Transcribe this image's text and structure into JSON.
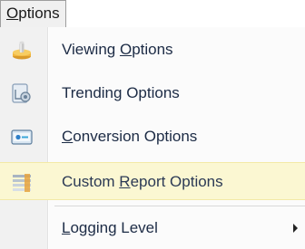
{
  "menubar": {
    "options": {
      "pre": "",
      "ul": "O",
      "post": "ptions"
    }
  },
  "menu": {
    "viewing": {
      "pre": "Viewing ",
      "ul": "O",
      "post": "ptions",
      "icon": "viewing-options-icon"
    },
    "trending": {
      "pre": "Trending Options",
      "ul": "",
      "post": "",
      "icon": "trending-options-icon"
    },
    "conversion": {
      "pre": "",
      "ul": "C",
      "post": "onversion Options",
      "icon": "conversion-options-icon"
    },
    "custom_report": {
      "pre": "Custom ",
      "ul": "R",
      "post": "eport Options",
      "icon": "custom-report-options-icon",
      "highlighted": true
    },
    "logging": {
      "pre": "",
      "ul": "L",
      "post": "ogging Level",
      "has_submenu": true
    }
  },
  "colors": {
    "highlight_bg": "#fbf7d2",
    "text": "#1c2b45"
  }
}
